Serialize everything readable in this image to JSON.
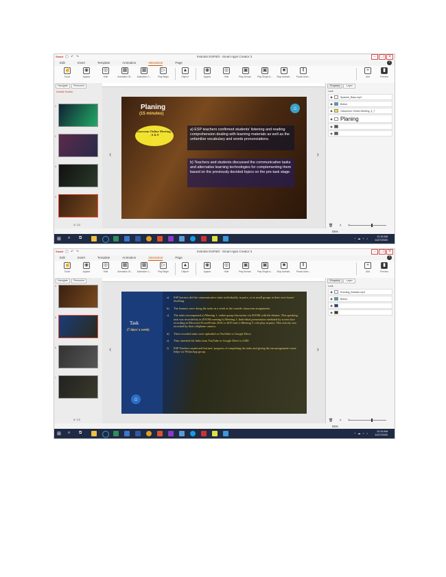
{
  "window": {
    "title": "Instruksi ESPahl - Smart Apps Creator 3",
    "logo": "Smart",
    "min": "–",
    "max": "❐",
    "close": "✕"
  },
  "menu": [
    "Edit",
    "Insert",
    "Template",
    "Animation",
    "Interaction",
    "Page"
  ],
  "menu_active": "Interaction",
  "ribbon": [
    {
      "label": "Touch",
      "icon": "hand-icon"
    },
    {
      "label": "Appear",
      "icon": "eye-icon"
    },
    {
      "label": "Hide",
      "icon": "eye-off-icon"
    },
    {
      "label": "Animation St...",
      "icon": "film-icon"
    },
    {
      "label": "Animation C...",
      "icon": "film-icon"
    },
    {
      "label": "Play Begin",
      "icon": "play-icon"
    },
    {
      "label": "Object+",
      "icon": "object-icon"
    },
    {
      "label": "Appear",
      "icon": "eye-icon"
    },
    {
      "label": "Hide",
      "icon": "eye-off-icon"
    },
    {
      "label": "Play Animat...",
      "icon": "play-icon"
    },
    {
      "label": "Play Single A...",
      "icon": "play-icon"
    },
    {
      "label": "Stop Animati...",
      "icon": "stop-icon"
    },
    {
      "label": "Pause Anim...",
      "icon": "pause-icon"
    },
    {
      "label": "Add",
      "icon": "add-icon"
    },
    {
      "label": "Preview",
      "icon": "preview-icon"
    }
  ],
  "left_tabs": [
    "Navigate",
    "Resource"
  ],
  "section_label": "Default Section",
  "right_tabs": [
    "Property",
    "Layer"
  ],
  "lock_label": "Lock",
  "zoom": "55%",
  "shot1": {
    "page": "4 / 12",
    "clock_time": "11:15 AM",
    "clock_date": "11/27/2020",
    "layers": [
      "Spanish_Bass.mp3",
      "Button",
      "Classroom Online Meeting_4_7",
      "Planing"
    ],
    "slide": {
      "title": "Planing",
      "subtitle": "(15 minutes)",
      "bubble": "Classroom Online Meeting, 4 , 6 & 8",
      "a": "a)  ESP teachers confirmed students' listening and reading comprehension dealing with learning materials as well as the unfamiliar vocabulary and words pronunciations.",
      "b": "b)  Teachers and students discussed the communicative tasks and alternative learning technologies for complementing them based on the previously decided topics on the pre-task stage."
    }
  },
  "shot2": {
    "page": "5 / 12",
    "clock_time": "12:15 AM",
    "clock_date": "11/27/2020",
    "layers": [
      "Running_Bossian.mp3",
      "Button",
      "",
      ""
    ],
    "slide": {
      "title": "Task",
      "subtitle": "(7 days/ a week)",
      "items": [
        {
          "lbl": "a)",
          "text": "ESP learners did the communicative tasks individually, in pairs, or in small groups at their own house/ dwelling."
        },
        {
          "lbl": "b)",
          "text": "The learners were doing the tasks in a week as the outside classroom assignments."
        },
        {
          "lbl": "c)",
          "text": "The tasks encompassed a) Meeting 1. online group discussion via ZOOM with the themes. This speaking task was recorded by in ZOOM meeting b) Meeting 3. Individual presentation mediated by screen face recording in Microsoft PowerPoints 2016 or 2019 and c) Meeting 5. role-play in pairs. This activity was recorded by their cellphone camera."
        },
        {
          "lbl": "d)",
          "text": "Their recorded tasks were uploaded on YouTube or Google Drive."
        },
        {
          "lbl": "e)",
          "text": "They attached the links from YouTube or Google Drive to LMS"
        },
        {
          "lbl": "f)",
          "text": "ESP Teachers monitored learners' progress of completing the tasks and giving the encouragement/ some helps via WhatsApp group."
        }
      ]
    }
  },
  "colors": {
    "accent": "#d35400",
    "taskbar": "#1f2a44",
    "yellow": "#f2e22f",
    "gold": "#f5d36a"
  }
}
